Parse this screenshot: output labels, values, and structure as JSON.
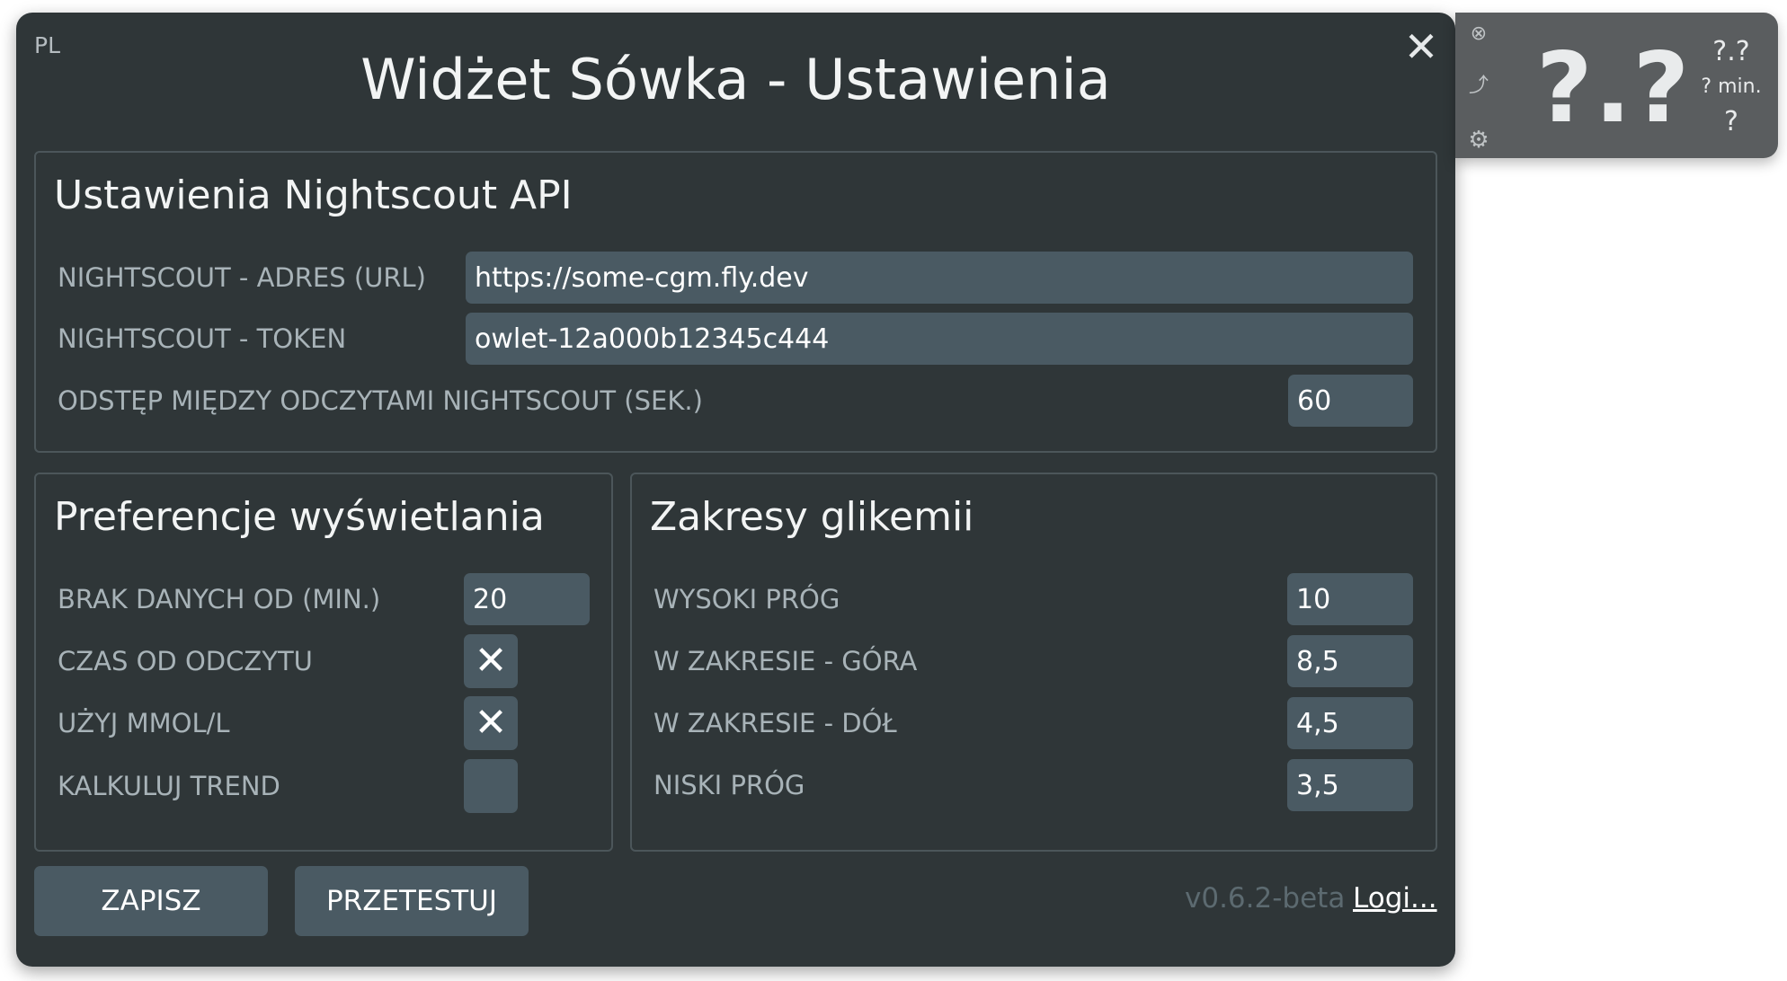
{
  "window": {
    "lang": "PL",
    "title": "Widżet Sówka - Ustawienia",
    "close_glyph": "✕"
  },
  "nightscout": {
    "title": "Ustawienia Nightscout API",
    "url_label": "NIGHTSCOUT - ADRES (URL)",
    "url_value": "https://some-cgm.fly.dev",
    "token_label": "NIGHTSCOUT - TOKEN",
    "token_value": "owlet-12a000b12345c444",
    "interval_label": "ODSTĘP MIĘDZY ODCZYTAMI NIGHTSCOUT (SEK.)",
    "interval_value": "60"
  },
  "display": {
    "title": "Preferencje wyświetlania",
    "nodata_label": "BRAK DANYCH OD (MIN.)",
    "nodata_value": "20",
    "time_label": "CZAS OD ODCZYTU",
    "time_checked": "✕",
    "mmol_label": "UŻYJ MMOL/L",
    "mmol_checked": "✕",
    "trend_label": "KALKULUJ TREND",
    "trend_checked": ""
  },
  "ranges": {
    "title": "Zakresy glikemii",
    "high_label": "WYSOKI PRÓG",
    "high_value": "10",
    "top_label": "W ZAKRESIE - GÓRA",
    "top_value": "8,5",
    "bottom_label": "W ZAKRESIE - DÓŁ",
    "bottom_value": "4,5",
    "low_label": "NISKI PRÓG",
    "low_value": "3,5"
  },
  "footer": {
    "save_label": "ZAPISZ",
    "test_label": "PRZETESTUJ",
    "version": "v0.6.2-beta",
    "logs_label": "Logi..."
  },
  "widget": {
    "close_icon": "⊗",
    "trend_icon": "⤴",
    "settings_icon": "⚙",
    "value": "?.?",
    "delta": "?.?",
    "minutes": "? min.",
    "arrow": "?"
  },
  "colors": {
    "window_bg": "#2f3638",
    "input_bg": "#4a5a63",
    "label": "#a8b3b8",
    "widget_bg": "#5a5d5f"
  }
}
